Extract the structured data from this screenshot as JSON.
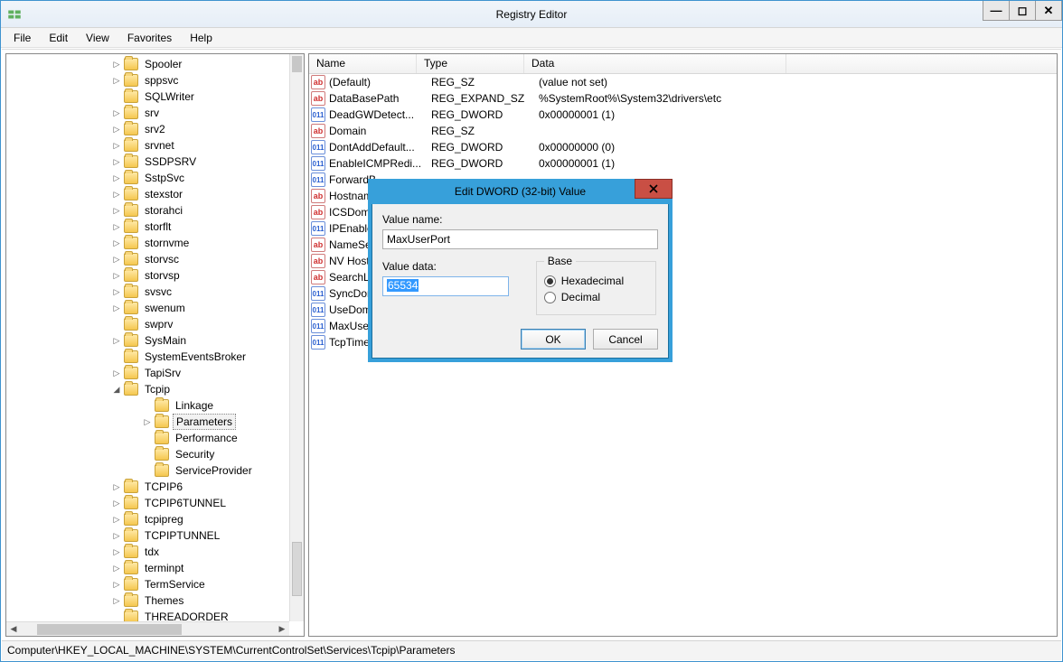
{
  "window": {
    "title": "Registry Editor"
  },
  "menubar": [
    "File",
    "Edit",
    "View",
    "Favorites",
    "Help"
  ],
  "tree": {
    "indent_base": 116,
    "child_indent": 150,
    "items": [
      {
        "label": "Spooler",
        "exp": "▷"
      },
      {
        "label": "sppsvc",
        "exp": "▷"
      },
      {
        "label": "SQLWriter",
        "exp": ""
      },
      {
        "label": "srv",
        "exp": "▷"
      },
      {
        "label": "srv2",
        "exp": "▷"
      },
      {
        "label": "srvnet",
        "exp": "▷"
      },
      {
        "label": "SSDPSRV",
        "exp": "▷"
      },
      {
        "label": "SstpSvc",
        "exp": "▷"
      },
      {
        "label": "stexstor",
        "exp": "▷"
      },
      {
        "label": "storahci",
        "exp": "▷"
      },
      {
        "label": "storflt",
        "exp": "▷"
      },
      {
        "label": "stornvme",
        "exp": "▷"
      },
      {
        "label": "storvsc",
        "exp": "▷"
      },
      {
        "label": "storvsp",
        "exp": "▷"
      },
      {
        "label": "svsvc",
        "exp": "▷"
      },
      {
        "label": "swenum",
        "exp": "▷"
      },
      {
        "label": "swprv",
        "exp": ""
      },
      {
        "label": "SysMain",
        "exp": "▷"
      },
      {
        "label": "SystemEventsBroker",
        "exp": ""
      },
      {
        "label": "TapiSrv",
        "exp": "▷"
      },
      {
        "label": "Tcpip",
        "exp": "◢",
        "open": true,
        "children": [
          {
            "label": "Linkage",
            "exp": ""
          },
          {
            "label": "Parameters",
            "exp": "▷",
            "selected": true
          },
          {
            "label": "Performance",
            "exp": ""
          },
          {
            "label": "Security",
            "exp": ""
          },
          {
            "label": "ServiceProvider",
            "exp": ""
          }
        ]
      },
      {
        "label": "TCPIP6",
        "exp": "▷"
      },
      {
        "label": "TCPIP6TUNNEL",
        "exp": "▷"
      },
      {
        "label": "tcpipreg",
        "exp": "▷"
      },
      {
        "label": "TCPIPTUNNEL",
        "exp": "▷"
      },
      {
        "label": "tdx",
        "exp": "▷"
      },
      {
        "label": "terminpt",
        "exp": "▷"
      },
      {
        "label": "TermService",
        "exp": "▷"
      },
      {
        "label": "Themes",
        "exp": "▷"
      },
      {
        "label": "THREADORDER",
        "exp": ""
      }
    ]
  },
  "list": {
    "headers": {
      "name": "Name",
      "type": "Type",
      "data": "Data"
    },
    "rows": [
      {
        "icon": "str",
        "name": "(Default)",
        "type": "REG_SZ",
        "data": "(value not set)"
      },
      {
        "icon": "str",
        "name": "DataBasePath",
        "type": "REG_EXPAND_SZ",
        "data": "%SystemRoot%\\System32\\drivers\\etc"
      },
      {
        "icon": "bin",
        "name": "DeadGWDetect...",
        "type": "REG_DWORD",
        "data": "0x00000001 (1)"
      },
      {
        "icon": "str",
        "name": "Domain",
        "type": "REG_SZ",
        "data": ""
      },
      {
        "icon": "bin",
        "name": "DontAddDefault...",
        "type": "REG_DWORD",
        "data": "0x00000000 (0)"
      },
      {
        "icon": "bin",
        "name": "EnableICMPRedi...",
        "type": "REG_DWORD",
        "data": "0x00000001 (1)"
      },
      {
        "icon": "bin",
        "name": "ForwardB",
        "type": "",
        "data": ""
      },
      {
        "icon": "str",
        "name": "Hostnam",
        "type": "",
        "data": ""
      },
      {
        "icon": "str",
        "name": "ICSDoma",
        "type": "",
        "data": ""
      },
      {
        "icon": "bin",
        "name": "IPEnable",
        "type": "",
        "data": ""
      },
      {
        "icon": "str",
        "name": "NameSer",
        "type": "",
        "data": ""
      },
      {
        "icon": "str",
        "name": "NV Host",
        "type": "",
        "data": ""
      },
      {
        "icon": "str",
        "name": "SearchLis",
        "type": "",
        "data": ""
      },
      {
        "icon": "bin",
        "name": "SyncDon",
        "type": "",
        "data": ""
      },
      {
        "icon": "bin",
        "name": "UseDom",
        "type": "",
        "data": ""
      },
      {
        "icon": "bin",
        "name": "MaxUser",
        "type": "",
        "data": ""
      },
      {
        "icon": "bin",
        "name": "TcpTime",
        "type": "",
        "data": ""
      }
    ]
  },
  "statusbar": "Computer\\HKEY_LOCAL_MACHINE\\SYSTEM\\CurrentControlSet\\Services\\Tcpip\\Parameters",
  "dialog": {
    "title": "Edit DWORD (32-bit) Value",
    "value_name_label": "Value name:",
    "value_name": "MaxUserPort",
    "value_data_label": "Value data:",
    "value_data": "65534",
    "base_label": "Base",
    "radio_hex": "Hexadecimal",
    "radio_dec": "Decimal",
    "base_selected": "hex",
    "ok": "OK",
    "cancel": "Cancel"
  },
  "icons": {
    "str_text": "ab",
    "bin_text": "011"
  }
}
